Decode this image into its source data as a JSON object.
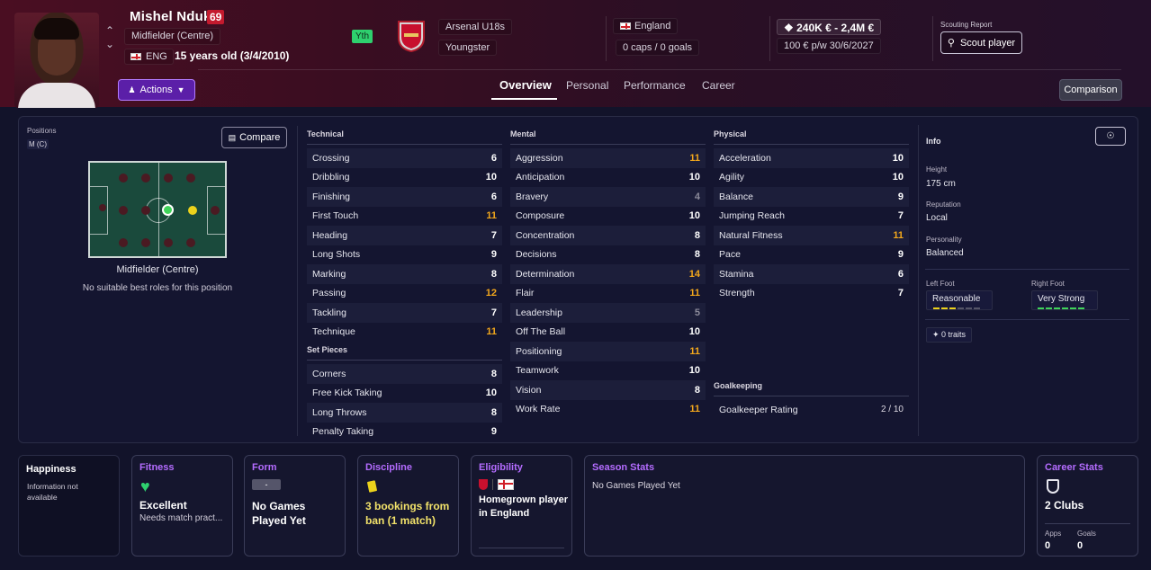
{
  "player": {
    "name": "Mishel Nduka",
    "ca": "69",
    "position": "Midfielder (Centre)",
    "nationality_code": "ENG",
    "age": "15 years old (3/4/2010)",
    "youth_badge": "Yth"
  },
  "club": {
    "team": "Arsenal U18s",
    "status": "Youngster"
  },
  "international": {
    "country": "England",
    "caps": "0 caps / 0 goals"
  },
  "contract": {
    "value": "240K € - 2,4M €",
    "wage": "100 € p/w  30/6/2027"
  },
  "scouting": {
    "label": "Scouting Report",
    "button": "Scout player"
  },
  "actions_label": "Actions",
  "tabs": [
    {
      "label": "Overview",
      "active": true
    },
    {
      "label": "Personal",
      "active": false
    },
    {
      "label": "Performance",
      "active": false
    },
    {
      "label": "Career",
      "active": false
    }
  ],
  "comparison_label": "Comparison",
  "positions": {
    "label": "Positions",
    "chip": "M (C)",
    "compare_label": "Compare",
    "pitch_label": "Midfielder (Centre)",
    "no_roles": "No suitable best roles for this position"
  },
  "technical": {
    "title": "Technical",
    "rows": [
      {
        "name": "Crossing",
        "value": "6"
      },
      {
        "name": "Dribbling",
        "value": "10"
      },
      {
        "name": "Finishing",
        "value": "6"
      },
      {
        "name": "First Touch",
        "value": "11"
      },
      {
        "name": "Heading",
        "value": "7"
      },
      {
        "name": "Long Shots",
        "value": "9"
      },
      {
        "name": "Marking",
        "value": "8"
      },
      {
        "name": "Passing",
        "value": "12"
      },
      {
        "name": "Tackling",
        "value": "7"
      },
      {
        "name": "Technique",
        "value": "11"
      }
    ]
  },
  "set_pieces": {
    "title": "Set Pieces",
    "rows": [
      {
        "name": "Corners",
        "value": "8"
      },
      {
        "name": "Free Kick Taking",
        "value": "10"
      },
      {
        "name": "Long Throws",
        "value": "8"
      },
      {
        "name": "Penalty Taking",
        "value": "9"
      }
    ]
  },
  "mental": {
    "title": "Mental",
    "rows": [
      {
        "name": "Aggression",
        "value": "11"
      },
      {
        "name": "Anticipation",
        "value": "10"
      },
      {
        "name": "Bravery",
        "value": "4"
      },
      {
        "name": "Composure",
        "value": "10"
      },
      {
        "name": "Concentration",
        "value": "8"
      },
      {
        "name": "Decisions",
        "value": "8"
      },
      {
        "name": "Determination",
        "value": "14"
      },
      {
        "name": "Flair",
        "value": "11"
      },
      {
        "name": "Leadership",
        "value": "5"
      },
      {
        "name": "Off The Ball",
        "value": "10"
      },
      {
        "name": "Positioning",
        "value": "11"
      },
      {
        "name": "Teamwork",
        "value": "10"
      },
      {
        "name": "Vision",
        "value": "8"
      },
      {
        "name": "Work Rate",
        "value": "11"
      }
    ]
  },
  "physical": {
    "title": "Physical",
    "rows": [
      {
        "name": "Acceleration",
        "value": "10"
      },
      {
        "name": "Agility",
        "value": "10"
      },
      {
        "name": "Balance",
        "value": "9"
      },
      {
        "name": "Jumping Reach",
        "value": "7"
      },
      {
        "name": "Natural Fitness",
        "value": "11"
      },
      {
        "name": "Pace",
        "value": "9"
      },
      {
        "name": "Stamina",
        "value": "6"
      },
      {
        "name": "Strength",
        "value": "7"
      }
    ]
  },
  "goalkeeping": {
    "title": "Goalkeeping",
    "label": "Goalkeeper Rating",
    "value": "2 / 10"
  },
  "info": {
    "title": "Info",
    "height_label": "Height",
    "height": "175 cm",
    "reputation_label": "Reputation",
    "reputation": "Local",
    "personality_label": "Personality",
    "personality": "Balanced",
    "left_foot_label": "Left Foot",
    "left_foot": "Reasonable",
    "left_foot_level": 3,
    "right_foot_label": "Right Foot",
    "right_foot": "Very Strong",
    "right_foot_level": 6,
    "traits": "0 traits"
  },
  "cards": {
    "happiness": {
      "title": "Happiness",
      "text": "Information not available"
    },
    "fitness": {
      "title": "Fitness",
      "status": "Excellent",
      "note": "Needs match pract..."
    },
    "form": {
      "title": "Form",
      "badge": "-",
      "text": "No Games Played Yet"
    },
    "discipline": {
      "title": "Discipline",
      "text": "3 bookings from ban (1 match)"
    },
    "eligibility": {
      "title": "Eligibility",
      "text": "Homegrown player in England"
    },
    "season": {
      "title": "Season Stats",
      "text": "No Games Played Yet"
    },
    "career": {
      "title": "Career Stats",
      "clubs": "2 Clubs",
      "apps_label": "Apps",
      "apps": "0",
      "goals_label": "Goals",
      "goals": "0"
    }
  },
  "colors": {
    "accent": "#b46cff",
    "highlight": "#f2a71c",
    "actions": "#5b1fa8",
    "green": "#2ed06e"
  }
}
